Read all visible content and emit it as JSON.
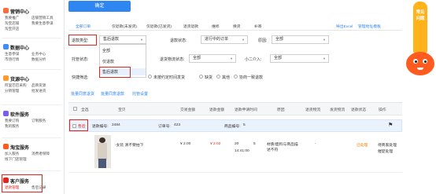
{
  "sidebar": {
    "sections": [
      {
        "title": "营销中心",
        "links": [
          "我要推广",
          "店铺营销工具",
          "淘宝店铺",
          "我要生意参谋",
          "淘宝开店",
          "淘金币"
        ]
      },
      {
        "title": "数据中心",
        "links": [
          "生意参谋",
          "业务中心",
          "市场行情",
          "数据分析"
        ]
      },
      {
        "title": "货源中心",
        "links": [
          "阿里巴巴采购",
          "品牌货源",
          "分销管理",
          "批发进货"
        ]
      },
      {
        "title": "软件服务",
        "links": [
          "我要订购",
          "订制服务",
          "我的服务",
          "已订购"
        ]
      },
      {
        "title": "淘宝服务",
        "links": [
          "加入服务",
          "消费者保障",
          "线下门店管理"
        ]
      },
      {
        "title": "客户服务",
        "links": [
          "退款管理",
          "售后记录"
        ]
      }
    ]
  },
  "toolbar": {
    "confirm_label": "确定"
  },
  "tabs": [
    "全部订单",
    "仅退款(未发货)",
    "仅退款(已发货)",
    "退货退款",
    "维修",
    "换货",
    "补寄"
  ],
  "tab_links": [
    "导出Excel",
    "管理地址模板"
  ],
  "filters": {
    "dispute_type_label": "退款类型:",
    "dispute_type_value": "售后退款",
    "dispute_options": [
      "全部",
      "仅退款",
      "售后退款"
    ],
    "refund_status_label": "退款状态:",
    "refund_status_value": "进行中的订单",
    "reason_label": "原因:",
    "reason_value": "全部",
    "custody_label": "托管状态:",
    "logistics_label": "退货物流状态:",
    "logistics_value": "全部",
    "intervention_label": "小二介入:",
    "intervention_value": "全部",
    "quick_label": "快捷筛选:",
    "quick_options": [
      "未发货仅退款",
      "未按约定时间发货",
      "缺货",
      "其他",
      "协商一致退款"
    ]
  },
  "batch_links": [
    "批量同意退货",
    "批量同意退款",
    "托管设置"
  ],
  "table": {
    "headers": [
      "全选",
      "宝贝",
      "交易金额",
      "退款金额",
      "退款申请时间",
      "原因",
      "退货物流",
      "发货物流",
      "退款状态",
      "操作"
    ],
    "order": {
      "tag": "售后",
      "refund_no_label": "退款编号:",
      "refund_no": "2484",
      "order_no_label": "订单号:",
      "order_no": "423",
      "product_id_label": "商品编号:",
      "product_id": "5"
    },
    "row": {
      "item_title": "-女装 清不要拍下",
      "trade_amount": "¥ 2.00",
      "refund_amount": "¥ 2.02",
      "apply_date": "20",
      "apply_time": "14:41:00",
      "apply_num": "5",
      "reason": "材质/面料与商品描述不符",
      "return_logistics": "-",
      "status": "已处理",
      "actions": [
        "待商家处理",
        "催促处理"
      ]
    }
  },
  "widget": {
    "label": "常见问题"
  },
  "colors": {
    "accent": "#2f86f1",
    "highlight": "#e0261b"
  }
}
